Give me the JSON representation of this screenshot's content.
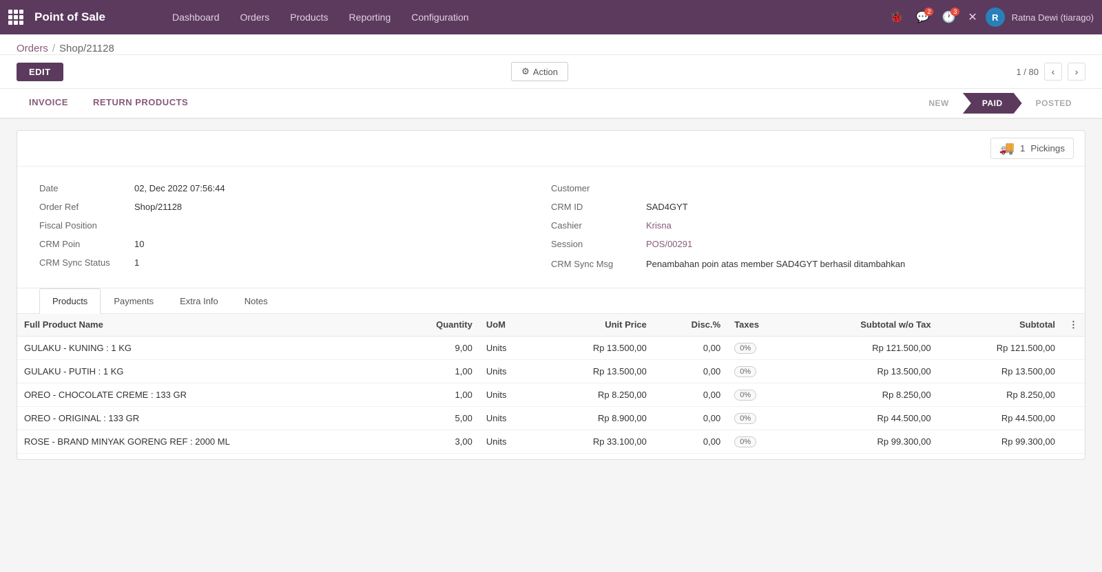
{
  "app": {
    "name": "Point of Sale"
  },
  "topnav": {
    "menu": [
      {
        "label": "Dashboard",
        "id": "dashboard"
      },
      {
        "label": "Orders",
        "id": "orders"
      },
      {
        "label": "Products",
        "id": "products"
      },
      {
        "label": "Reporting",
        "id": "reporting"
      },
      {
        "label": "Configuration",
        "id": "configuration"
      }
    ],
    "icons": [
      {
        "name": "bug-icon",
        "symbol": "🐞",
        "badge": null
      },
      {
        "name": "chat-icon",
        "symbol": "💬",
        "badge": "2"
      },
      {
        "name": "clock-icon",
        "symbol": "🕐",
        "badge": "3"
      },
      {
        "name": "close-icon",
        "symbol": "✕",
        "badge": null
      }
    ],
    "user": {
      "initial": "R",
      "name": "Ratna Dewi (tiarago)"
    }
  },
  "breadcrumb": {
    "parent": "Orders",
    "separator": "/",
    "current": "Shop/21128"
  },
  "toolbar": {
    "edit_label": "EDIT",
    "action_label": "Action",
    "pagination": "1 / 80"
  },
  "status_tabs": [
    {
      "label": "INVOICE",
      "id": "invoice"
    },
    {
      "label": "RETURN PRODUCTS",
      "id": "return_products"
    }
  ],
  "stages": [
    {
      "label": "NEW",
      "id": "new",
      "active": false
    },
    {
      "label": "PAID",
      "id": "paid",
      "active": true
    },
    {
      "label": "POSTED",
      "id": "posted",
      "active": false
    }
  ],
  "pickings": {
    "count": "1",
    "label": "Pickings"
  },
  "form": {
    "left": [
      {
        "label": "Date",
        "value": "02, Dec 2022 07:56:44",
        "type": "text"
      },
      {
        "label": "Order Ref",
        "value": "Shop/21128",
        "type": "text"
      },
      {
        "label": "Fiscal Position",
        "value": "",
        "type": "muted"
      },
      {
        "label": "CRM Poin",
        "value": "10",
        "type": "text"
      },
      {
        "label": "CRM Sync Status",
        "value": "1",
        "type": "text"
      }
    ],
    "right": [
      {
        "label": "Customer",
        "value": "",
        "type": "muted"
      },
      {
        "label": "CRM ID",
        "value": "SAD4GYT",
        "type": "text"
      },
      {
        "label": "Cashier",
        "value": "Krisna",
        "type": "link"
      },
      {
        "label": "Session",
        "value": "POS/00291",
        "type": "link"
      },
      {
        "label": "CRM Sync Msg",
        "value": "Penambahan poin atas member SAD4GYT berhasil ditambahkan",
        "type": "text"
      }
    ]
  },
  "tabs": [
    {
      "label": "Products",
      "id": "products",
      "active": true
    },
    {
      "label": "Payments",
      "id": "payments",
      "active": false
    },
    {
      "label": "Extra Info",
      "id": "extra_info",
      "active": false
    },
    {
      "label": "Notes",
      "id": "notes",
      "active": false
    }
  ],
  "table": {
    "headers": [
      {
        "label": "Full Product Name",
        "align": "left"
      },
      {
        "label": "Quantity",
        "align": "right"
      },
      {
        "label": "UoM",
        "align": "left"
      },
      {
        "label": "Unit Price",
        "align": "right"
      },
      {
        "label": "Disc.%",
        "align": "right"
      },
      {
        "label": "Taxes",
        "align": "left"
      },
      {
        "label": "Subtotal w/o Tax",
        "align": "right"
      },
      {
        "label": "Subtotal",
        "align": "right"
      }
    ],
    "rows": [
      {
        "name": "GULAKU - KUNING : 1 KG",
        "quantity": "9,00",
        "uom": "Units",
        "unit_price": "Rp 13.500,00",
        "disc": "0,00",
        "tax": "0%",
        "subtotal_wo_tax": "Rp 121.500,00",
        "subtotal": "Rp 121.500,00"
      },
      {
        "name": "GULAKU - PUTIH : 1 KG",
        "quantity": "1,00",
        "uom": "Units",
        "unit_price": "Rp 13.500,00",
        "disc": "0,00",
        "tax": "0%",
        "subtotal_wo_tax": "Rp 13.500,00",
        "subtotal": "Rp 13.500,00"
      },
      {
        "name": "OREO - CHOCOLATE CREME : 133 GR",
        "quantity": "1,00",
        "uom": "Units",
        "unit_price": "Rp 8.250,00",
        "disc": "0,00",
        "tax": "0%",
        "subtotal_wo_tax": "Rp 8.250,00",
        "subtotal": "Rp 8.250,00"
      },
      {
        "name": "OREO - ORIGINAL : 133 GR",
        "quantity": "5,00",
        "uom": "Units",
        "unit_price": "Rp 8.900,00",
        "disc": "0,00",
        "tax": "0%",
        "subtotal_wo_tax": "Rp 44.500,00",
        "subtotal": "Rp 44.500,00"
      },
      {
        "name": "ROSE - BRAND MINYAK GORENG REF : 2000 ML",
        "quantity": "3,00",
        "uom": "Units",
        "unit_price": "Rp 33.100,00",
        "disc": "0,00",
        "tax": "0%",
        "subtotal_wo_tax": "Rp 99.300,00",
        "subtotal": "Rp 99.300,00"
      }
    ]
  }
}
